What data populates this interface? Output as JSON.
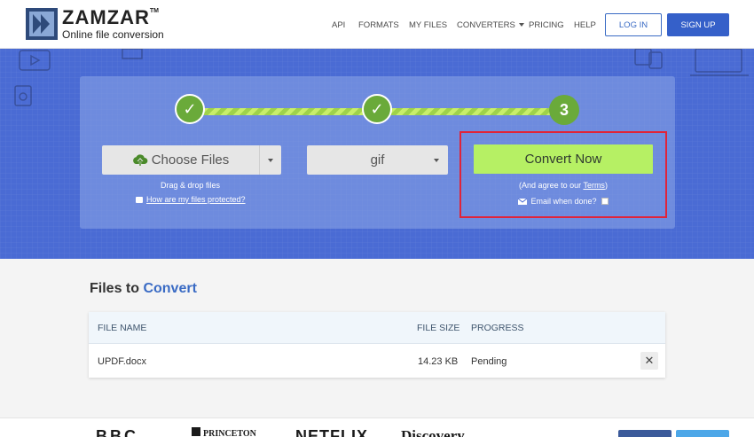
{
  "header": {
    "logo_name": "ZAMZAR",
    "logo_tm": "TM",
    "logo_tagline": "Online file conversion",
    "nav": [
      "API",
      "FORMATS",
      "MY FILES",
      "CONVERTERS",
      "PRICING",
      "HELP"
    ],
    "login": "LOG IN",
    "signup": "SIGN UP"
  },
  "steps": {
    "step3_number": "3",
    "choose_files": "Choose Files",
    "drag_drop": "Drag & drop files",
    "protected_link": "How are my files protected?",
    "format_selected": "gif",
    "convert_now": "Convert Now",
    "agree_prefix": "(And agree to our ",
    "agree_terms": "Terms",
    "agree_suffix": ")",
    "email_when_done": "Email when done?"
  },
  "files": {
    "title_prefix": "Files to ",
    "title_accent": "Convert",
    "columns": {
      "name": "FILE NAME",
      "size": "FILE SIZE",
      "progress": "PROGRESS"
    },
    "rows": [
      {
        "name": "UPDF.docx",
        "size": "14.23 KB",
        "progress": "Pending"
      }
    ],
    "remove_glyph": "✕"
  },
  "press": [
    "BBC",
    "PRINCETON",
    "NETFLIX",
    "Discovery"
  ],
  "colors": {
    "hero": "#4a6bd4",
    "accent": "#3a6bc4",
    "step_green": "#6aaa3a",
    "convert_green": "#b6f064",
    "highlight_red": "#e0243a"
  }
}
